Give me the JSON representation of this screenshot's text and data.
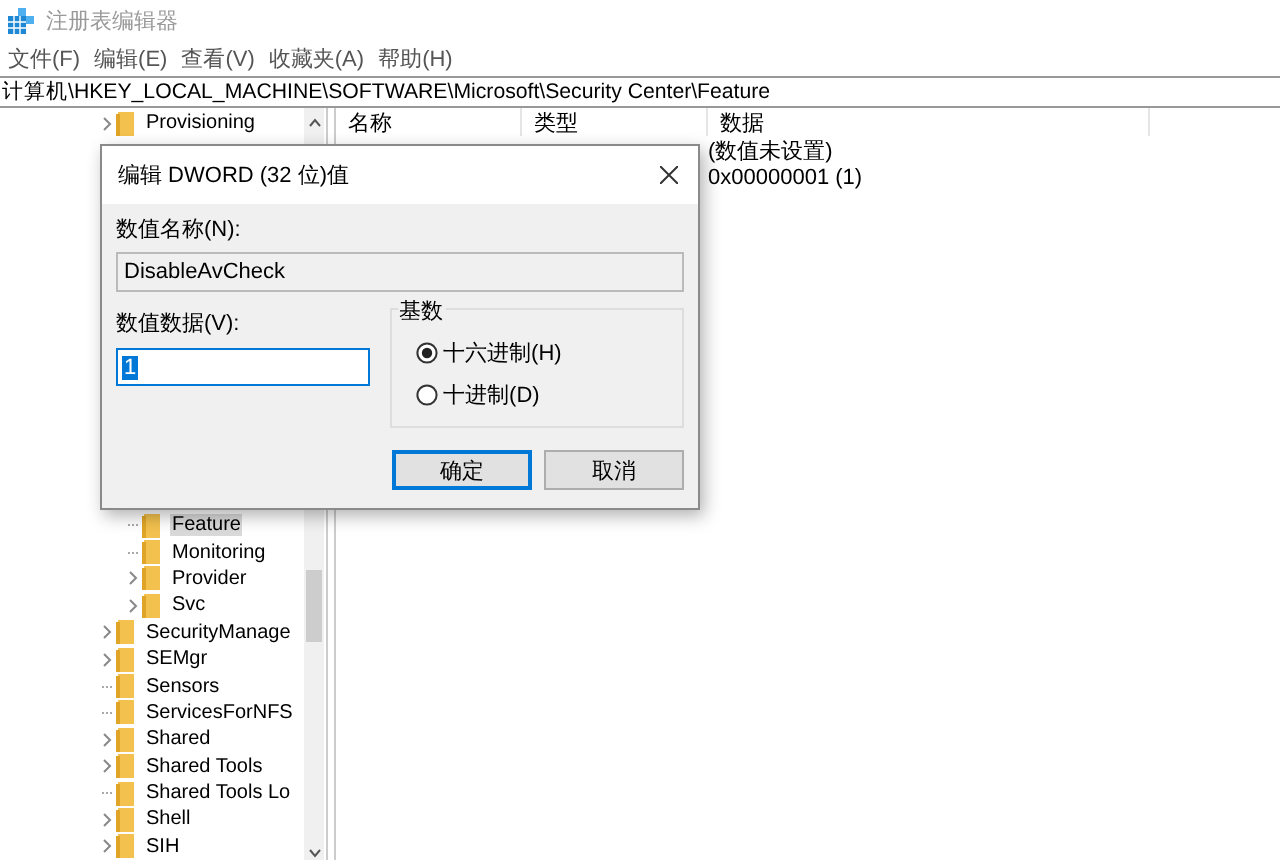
{
  "window": {
    "title": "注册表编辑器"
  },
  "menu": [
    "文件(F)",
    "编辑(E)",
    "查看(V)",
    "收藏夹(A)",
    "帮助(H)"
  ],
  "address": "计算机\\HKEY_LOCAL_MACHINE\\SOFTWARE\\Microsoft\\Security Center\\Feature",
  "tree": {
    "upper_items": [
      {
        "label": "Provisioning",
        "expandable": true,
        "selected": false
      }
    ],
    "lower_items": [
      {
        "children": [
          {
            "label": "Feature",
            "expandable": false,
            "selected": true
          },
          {
            "label": "Monitoring",
            "expandable": false,
            "selected": false
          },
          {
            "label": "Provider",
            "expandable": true,
            "selected": false
          },
          {
            "label": "Svc",
            "expandable": true,
            "selected": false
          }
        ]
      },
      {
        "label": "SecurityManage",
        "expandable": true,
        "selected": false
      },
      {
        "label": "SEMgr",
        "expandable": true,
        "selected": false
      },
      {
        "label": "Sensors",
        "expandable": false,
        "selected": false
      },
      {
        "label": "ServicesForNFS",
        "expandable": false,
        "selected": false
      },
      {
        "label": "Shared",
        "expandable": true,
        "selected": false
      },
      {
        "label": "Shared Tools",
        "expandable": true,
        "selected": false
      },
      {
        "label": "Shared Tools Lo",
        "expandable": false,
        "selected": false
      },
      {
        "label": "Shell",
        "expandable": true,
        "selected": false
      },
      {
        "label": "SIH",
        "expandable": true,
        "selected": false
      }
    ]
  },
  "list": {
    "columns": [
      "名称",
      "类型",
      "数据"
    ],
    "rows": [
      {
        "data": "(数值未设置)"
      },
      {
        "data": "0x00000001 (1)"
      }
    ]
  },
  "dialog": {
    "title": "编辑 DWORD (32 位)值",
    "name_label": "数值名称(N):",
    "name_value": "DisableAvCheck",
    "data_label": "数值数据(V):",
    "data_value": "1",
    "base_label": "基数",
    "bases": [
      {
        "label": "十六进制(H)",
        "selected": true
      },
      {
        "label": "十进制(D)",
        "selected": false
      }
    ],
    "buttons": [
      {
        "label": "确定",
        "default": true
      },
      {
        "label": "取消",
        "default": false
      }
    ]
  }
}
